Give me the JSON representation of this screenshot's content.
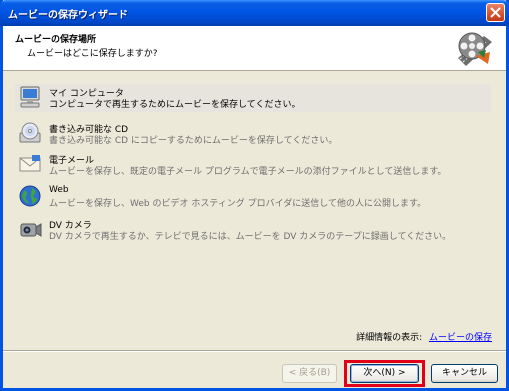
{
  "window": {
    "title": "ムービーの保存ウィザード"
  },
  "header": {
    "title": "ムービーの保存場所",
    "subtitle": "ムービーはどこに保存しますか?",
    "icon": "film-reel-icon"
  },
  "options": [
    {
      "label": "マイ コンピュータ",
      "description": "コンピュータで再生するためにムービーを保存してください。",
      "icon": "computer-icon",
      "selected": true
    },
    {
      "label": "書き込み可能な CD",
      "description": "書き込み可能な CD にコピーするためにムービーを保存してください。",
      "icon": "cd-icon",
      "selected": false
    },
    {
      "label": "電子メール",
      "description": "ムービーを保存し、既定の電子メール プログラムで電子メールの添付ファイルとして送信します。",
      "icon": "email-icon",
      "selected": false
    },
    {
      "label": "Web",
      "description": "ムービーを保存し、Web のビデオ ホスティング プロバイダに送信して他の人に公開します。",
      "icon": "web-globe-icon",
      "selected": false
    },
    {
      "label": "DV カメラ",
      "description": "DV カメラで再生するか、テレビで見るには、ムービーを DV カメラのテープに録画してください。",
      "icon": "dv-camera-icon",
      "selected": false
    }
  ],
  "details": {
    "label": "詳細情報の表示:",
    "link": "ムービーの保存"
  },
  "buttons": {
    "back": "< 戻る(B)",
    "next": "次へ(N) >",
    "cancel": "キャンセル"
  },
  "colors": {
    "titlebar": "#0054e3",
    "highlight": "#e0001a",
    "link": "#0000ff"
  }
}
